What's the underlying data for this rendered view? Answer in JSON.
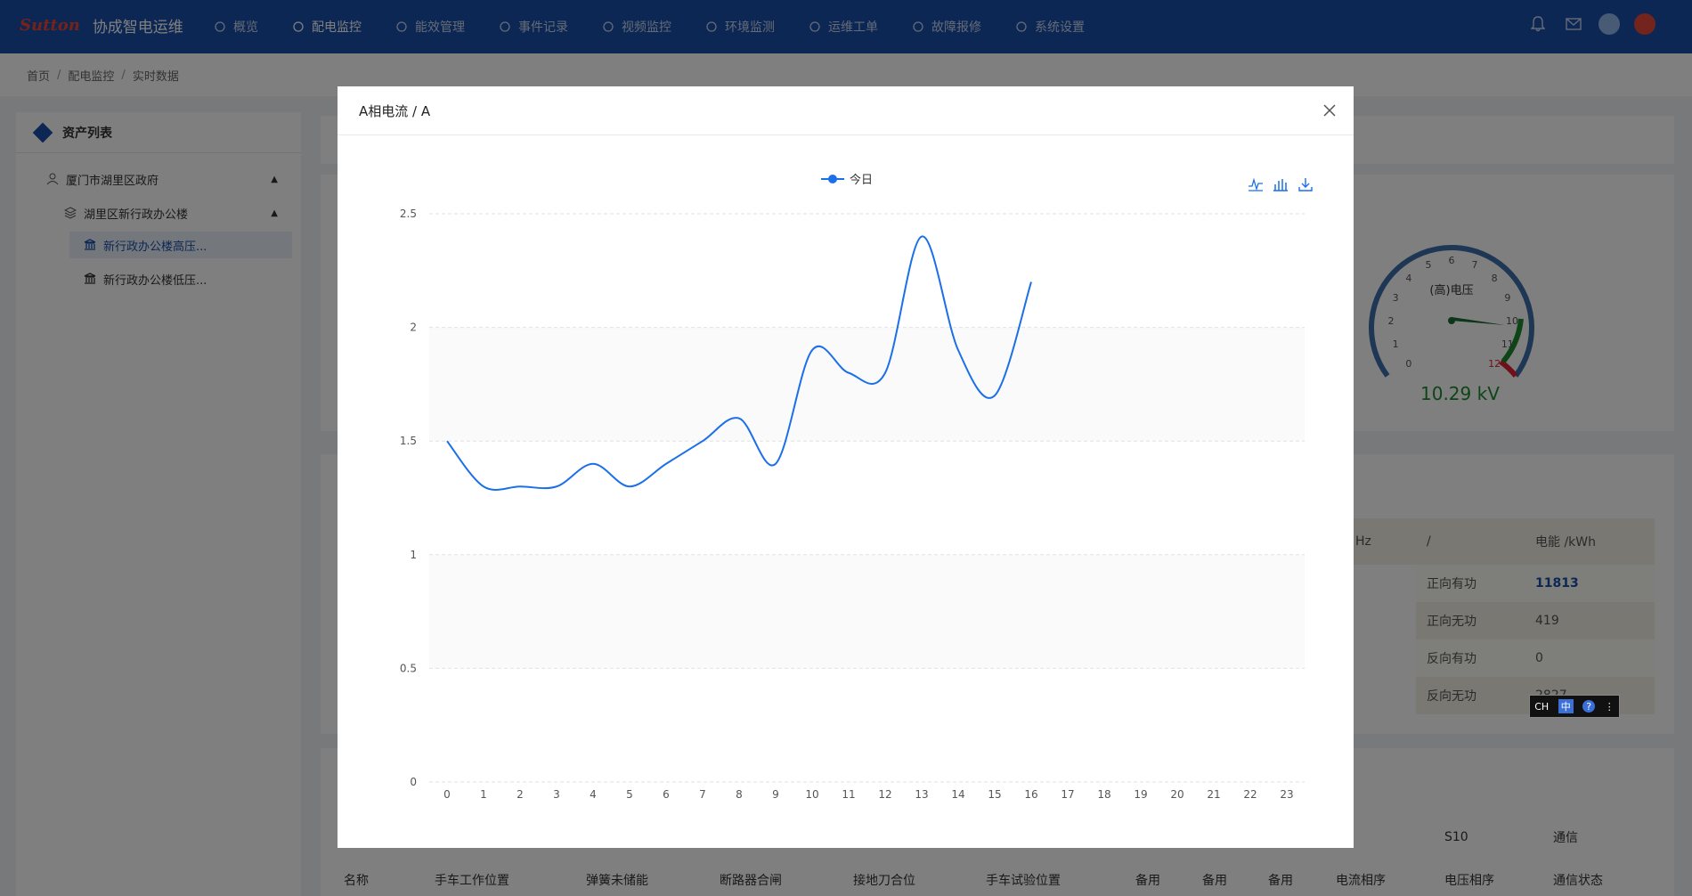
{
  "app": {
    "logo_mark": "Sutton",
    "title": "协成智电运维"
  },
  "nav": [
    {
      "label": "概览",
      "icon": "overview-icon"
    },
    {
      "label": "配电监控",
      "icon": "monitor-icon",
      "active": true
    },
    {
      "label": "能效管理",
      "icon": "energy-icon"
    },
    {
      "label": "事件记录",
      "icon": "event-icon"
    },
    {
      "label": "视频监控",
      "icon": "video-icon"
    },
    {
      "label": "环境监测",
      "icon": "environment-icon"
    },
    {
      "label": "运维工单",
      "icon": "workorder-icon"
    },
    {
      "label": "故障报修",
      "icon": "repair-icon"
    },
    {
      "label": "系统设置",
      "icon": "settings-icon"
    }
  ],
  "breadcrumb": [
    "首页",
    "配电监控",
    "实时数据"
  ],
  "sidebar": {
    "title": "资产列表",
    "items": [
      {
        "label": "厦门市湖里区政府"
      },
      {
        "label": "湖里区新行政办公楼"
      },
      {
        "label": "新行政办公楼高压..."
      },
      {
        "label": "新行政办公楼低压..."
      }
    ]
  },
  "gauge": {
    "title": "(高)电压",
    "value_text": "10.29 kV",
    "ticks": [
      "0",
      "1",
      "2",
      "3",
      "4",
      "5",
      "6",
      "7",
      "8",
      "9",
      "10",
      "11",
      "12"
    ]
  },
  "energy_table": {
    "header_partial": "Hz",
    "header_slash": "/",
    "header_unit": "电能 /kWh",
    "rows": [
      {
        "label": "正向有功",
        "value": "11813"
      },
      {
        "label": "正向无功",
        "value": "419"
      },
      {
        "label": "反向有功",
        "value": "0"
      },
      {
        "label": "反向无功",
        "value": "2827"
      }
    ]
  },
  "status_header": {
    "s10": "S10",
    "comm": "通信"
  },
  "status_columns": [
    "名称",
    "手车工作位置",
    "弹簧未储能",
    "断路器合闸",
    "接地刀合位",
    "手车试验位置",
    "备用",
    "备用",
    "备用",
    "电流相序",
    "电压相序",
    "通信状态"
  ],
  "modal": {
    "title": "A相电流 / A"
  },
  "ime": {
    "lang": "CH"
  },
  "chart_data": {
    "type": "line",
    "x": [
      "0",
      "1",
      "2",
      "3",
      "4",
      "5",
      "6",
      "7",
      "8",
      "9",
      "10",
      "11",
      "12",
      "13",
      "14",
      "15",
      "16",
      "17",
      "18",
      "19",
      "20",
      "21",
      "22",
      "23"
    ],
    "series": [
      {
        "name": "今日",
        "color": "#1b6fe8",
        "values": [
          1.5,
          1.3,
          1.3,
          1.3,
          1.4,
          1.3,
          1.4,
          1.5,
          1.6,
          1.4,
          1.9,
          1.8,
          1.8,
          2.4,
          1.9,
          1.7,
          2.2
        ]
      }
    ],
    "ylim": [
      0,
      2.5
    ],
    "yticks": [
      "0",
      "0.5",
      "1",
      "1.5",
      "2",
      "2.5"
    ],
    "grid": true,
    "legend": "top-center"
  }
}
